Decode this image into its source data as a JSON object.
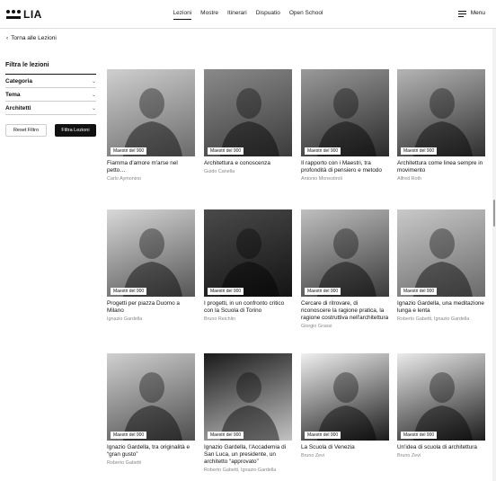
{
  "brand": {
    "name": "LIA"
  },
  "nav": {
    "items": [
      "Lezioni",
      "Mostre",
      "Itinerari",
      "Dispuatio",
      "Open School"
    ],
    "active": "Lezioni"
  },
  "menu": {
    "label": "Menu"
  },
  "back": {
    "label": "Torna alle Lezioni"
  },
  "sidebar": {
    "heading": "Filtra le lezioni",
    "filters": [
      "Categoria",
      "Tema",
      "Architetti"
    ],
    "reset_label": "Reset Filtro",
    "apply_label": "Filtra Lezioni"
  },
  "cards": [
    {
      "badge": "Maestri del 900",
      "title": "Fiamma d'amore m'arse nel petto…",
      "author": "Carlo Aymonino"
    },
    {
      "badge": "Maestri del 900",
      "title": "Architettura e conoscenza",
      "author": "Guido Canella"
    },
    {
      "badge": "Maestri del 900",
      "title": "Il rapporto con i Maestri, tra profondità di pensiero e metodo",
      "author": "Antonio Monestiroli"
    },
    {
      "badge": "Maestri del 900",
      "title": "Architettura come linea sempre in movimento",
      "author": "Alfred Roth"
    },
    {
      "badge": "Maestri del 900",
      "title": "Progetti per piazza Duomo a Milano",
      "author": "Ignazio Gardella"
    },
    {
      "badge": "Maestri del 900",
      "title": "I progetti, in un confronto critico con la Scuola di Torino",
      "author": "Bruno Reichlin"
    },
    {
      "badge": "Maestri del 900",
      "title": "Cercare di ritrovare, di riconoscere la ragione pratica, la ragione costruttiva nell'architettura",
      "author": "Giorgio Grassi"
    },
    {
      "badge": "Maestri del 900",
      "title": "Ignazio Gardella, una meditazione lunga e lenta",
      "author": "Roberto Gabetti, Ignazio Gardella"
    },
    {
      "badge": "Maestri del 900",
      "title": "Ignazio Gardella, tra originalità e “gran gusto”",
      "author": "Roberto Gabetti"
    },
    {
      "badge": "Maestri del 900",
      "title": "Ignazio Gardella, l'Accademia di San Luca, un presidente, un architetto “approvato”",
      "author": "Roberto Gabetti, Ignazio Gardella"
    },
    {
      "badge": "Maestri del 900",
      "title": "La Scuola di Venezia",
      "author": "Bruno Zevi"
    },
    {
      "badge": "Maestri del 900",
      "title": "Un'idea di scuola di architettura",
      "author": "Bruno Zevi"
    }
  ]
}
